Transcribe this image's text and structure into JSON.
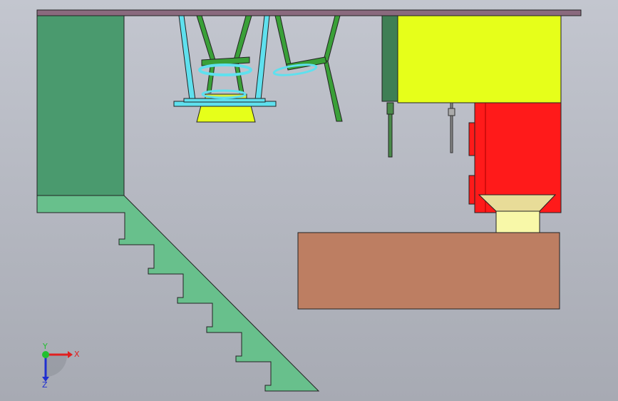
{
  "view": {
    "background_top": "#c3c6cf",
    "background_bottom": "#a7aab3"
  },
  "triad": {
    "x_label": "X",
    "y_label": "Y",
    "z_label": "Z",
    "x_color": "#e02020",
    "y_color": "#22c030",
    "z_color": "#2030d0"
  },
  "colors": {
    "ceiling_slab": "#8a6a7e",
    "wall_block": "#4a9a6e",
    "stair": "#68c08c",
    "frame_cyan": "#5fe0ee",
    "frame_green": "#3aa038",
    "hopper_yellow": "#e6ff1a",
    "machine_yellow": "#e6ff1a",
    "machine_red": "#ff1a1a",
    "funnel": "#e8dc98",
    "funnel_throat": "#f8f8a8",
    "base_block": "#bd7e62"
  }
}
